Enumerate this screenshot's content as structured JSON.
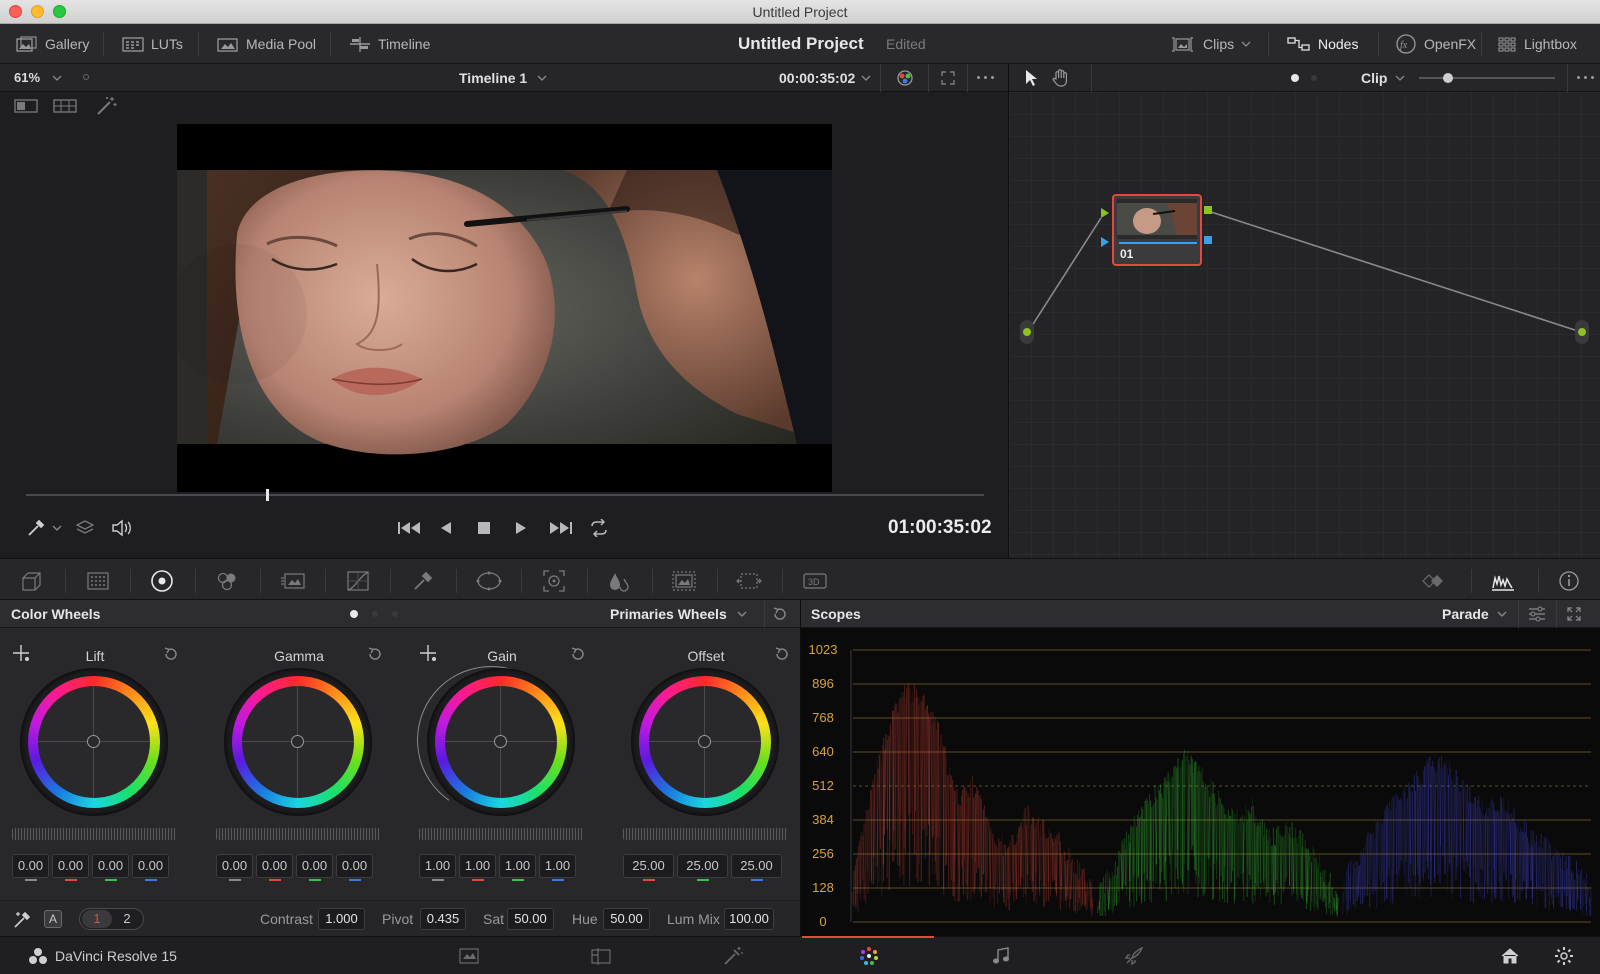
{
  "window": {
    "title": "Untitled Project"
  },
  "toolbar": {
    "gallery": "Gallery",
    "luts": "LUTs",
    "media_pool": "Media Pool",
    "timeline": "Timeline",
    "project_name": "Untitled Project",
    "project_status": "Edited",
    "clips": "Clips",
    "nodes": "Nodes",
    "openfx": "OpenFX",
    "lightbox": "Lightbox"
  },
  "viewer": {
    "zoom": "61%",
    "timeline_name": "Timeline 1",
    "timecode_top": "00:00:35:02",
    "timecode": "01:00:35:02",
    "scrub_position": 0.25
  },
  "nodes": {
    "mode": "Clip",
    "node_label": "01"
  },
  "color_wheels": {
    "title": "Color Wheels",
    "mode": "Primaries Wheels",
    "wheels": [
      {
        "name": "Lift",
        "values": [
          "0.00",
          "0.00",
          "0.00",
          "0.00"
        ]
      },
      {
        "name": "Gamma",
        "values": [
          "0.00",
          "0.00",
          "0.00",
          "0.00"
        ]
      },
      {
        "name": "Gain",
        "values": [
          "1.00",
          "1.00",
          "1.00",
          "1.00"
        ]
      },
      {
        "name": "Offset",
        "values": [
          "25.00",
          "25.00",
          "25.00"
        ]
      }
    ],
    "page1": "1",
    "page2": "2",
    "auto_label": "A",
    "contrast_label": "Contrast",
    "contrast": "1.000",
    "pivot_label": "Pivot",
    "pivot": "0.435",
    "sat_label": "Sat",
    "sat": "50.00",
    "hue_label": "Hue",
    "hue": "50.00",
    "lummix_label": "Lum Mix",
    "lummix": "100.00"
  },
  "scopes": {
    "title": "Scopes",
    "mode": "Parade",
    "y_ticks": [
      "1023",
      "896",
      "768",
      "640",
      "512",
      "384",
      "256",
      "128",
      "0"
    ]
  },
  "status": {
    "app_name": "DaVinci Resolve 15"
  },
  "colors": {
    "accent_red": "#e24a3b",
    "node_green": "#8dc21f",
    "scope_grid": "#c8a040"
  }
}
